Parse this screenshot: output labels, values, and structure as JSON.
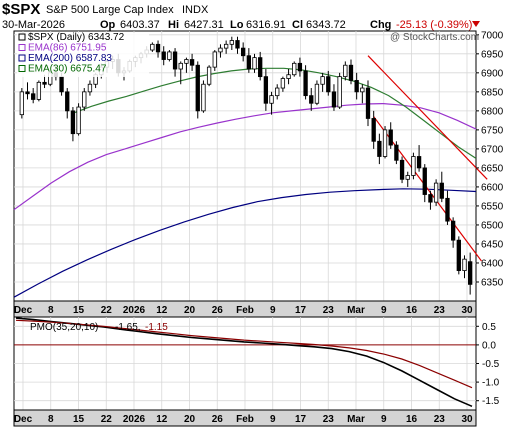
{
  "header": {
    "symbol": "$SPX",
    "name": "S&P 500 Large Cap Index",
    "exchange": "INDX",
    "date": "30-Mar-2026",
    "open_label": "Op",
    "open": "6403.37",
    "high_label": "Hi",
    "high": "6427.31",
    "low_label": "Lo",
    "low": "6316.91",
    "close_label": "Cl",
    "close": "6343.72",
    "chg_label": "Chg",
    "chg": "-25.13 (-0.39%)"
  },
  "watermark": "@ StockCharts.com",
  "legend": [
    {
      "label": "$SPX (Daily) 6343.72",
      "color": "#000000"
    },
    {
      "label": "EMA(86) 6751.95",
      "color": "#9933cc"
    },
    {
      "label": "EMA(200) 6587.83",
      "color": "#000080"
    },
    {
      "label": "EMA(30) 6675.47",
      "color": "#006600"
    }
  ],
  "pmo_legend": {
    "prefix": "PMO(35,20,10)",
    "pmo": "-1.65,",
    "signal": "-1.15"
  },
  "colors": {
    "up": "#ffffff",
    "down": "#000000",
    "ema86": "#9933cc",
    "ema200": "#000080",
    "ema30": "#2e7d32",
    "channel": "#dd0000",
    "pmo": "#000000",
    "pmo_signal": "#8b0000",
    "zero": "#8b0000"
  },
  "chart_data": [
    {
      "type": "candlestick",
      "title": "$SPX (Daily)",
      "x_ticks": [
        "Dec",
        "8",
        "15",
        "22",
        "2026",
        "12",
        "20",
        "26",
        "Feb",
        "9",
        "17",
        "23",
        "Mar",
        "9",
        "16",
        "23",
        "30"
      ],
      "ylim": [
        6300,
        7010
      ],
      "y_ticks": [
        6350,
        6400,
        6450,
        6500,
        6550,
        6600,
        6650,
        6700,
        6750,
        6800,
        6850,
        6900,
        6950,
        7000
      ],
      "ohlc": [
        [
          6790,
          6860,
          6780,
          6850
        ],
        [
          6850,
          6875,
          6830,
          6845
        ],
        [
          6845,
          6860,
          6820,
          6830
        ],
        [
          6830,
          6880,
          6825,
          6875
        ],
        [
          6875,
          6895,
          6860,
          6870
        ],
        [
          6870,
          6905,
          6865,
          6900
        ],
        [
          6900,
          6920,
          6880,
          6890
        ],
        [
          6890,
          6900,
          6840,
          6850
        ],
        [
          6850,
          6860,
          6780,
          6800
        ],
        [
          6800,
          6810,
          6720,
          6740
        ],
        [
          6740,
          6820,
          6735,
          6810
        ],
        [
          6810,
          6860,
          6800,
          6850
        ],
        [
          6850,
          6880,
          6840,
          6870
        ],
        [
          6870,
          6900,
          6860,
          6895
        ],
        [
          6895,
          6925,
          6885,
          6915
        ],
        [
          6915,
          6935,
          6900,
          6930
        ],
        [
          6930,
          6945,
          6910,
          6935
        ],
        [
          6935,
          6950,
          6890,
          6900
        ],
        [
          6900,
          6915,
          6880,
          6905
        ],
        [
          6905,
          6935,
          6900,
          6930
        ],
        [
          6930,
          6945,
          6915,
          6940
        ],
        [
          6940,
          6955,
          6925,
          6950
        ],
        [
          6950,
          6970,
          6940,
          6960
        ],
        [
          6960,
          6980,
          6955,
          6975
        ],
        [
          6975,
          6985,
          6940,
          6955
        ],
        [
          6955,
          6970,
          6920,
          6935
        ],
        [
          6935,
          6960,
          6930,
          6955
        ],
        [
          6955,
          6965,
          6890,
          6910
        ],
        [
          6910,
          6930,
          6870,
          6925
        ],
        [
          6925,
          6940,
          6900,
          6935
        ],
        [
          6935,
          6950,
          6905,
          6920
        ],
        [
          6920,
          6930,
          6780,
          6800
        ],
        [
          6800,
          6880,
          6795,
          6870
        ],
        [
          6870,
          6920,
          6865,
          6915
        ],
        [
          6915,
          6960,
          6905,
          6955
        ],
        [
          6955,
          6975,
          6940,
          6965
        ],
        [
          6965,
          6985,
          6950,
          6975
        ],
        [
          6975,
          6995,
          6960,
          6985
        ],
        [
          6985,
          6995,
          6950,
          6965
        ],
        [
          6965,
          6980,
          6930,
          6945
        ],
        [
          6945,
          6965,
          6900,
          6910
        ],
        [
          6910,
          6950,
          6900,
          6940
        ],
        [
          6940,
          6955,
          6880,
          6890
        ],
        [
          6890,
          6910,
          6800,
          6820
        ],
        [
          6820,
          6850,
          6790,
          6840
        ],
        [
          6840,
          6870,
          6830,
          6860
        ],
        [
          6860,
          6890,
          6850,
          6885
        ],
        [
          6885,
          6910,
          6870,
          6895
        ],
        [
          6895,
          6930,
          6890,
          6925
        ],
        [
          6925,
          6940,
          6890,
          6905
        ],
        [
          6905,
          6920,
          6830,
          6840
        ],
        [
          6840,
          6860,
          6800,
          6820
        ],
        [
          6820,
          6880,
          6815,
          6870
        ],
        [
          6870,
          6900,
          6850,
          6890
        ],
        [
          6890,
          6905,
          6840,
          6850
        ],
        [
          6850,
          6870,
          6800,
          6810
        ],
        [
          6810,
          6900,
          6805,
          6890
        ],
        [
          6890,
          6930,
          6880,
          6920
        ],
        [
          6920,
          6935,
          6870,
          6880
        ],
        [
          6880,
          6900,
          6830,
          6850
        ],
        [
          6850,
          6870,
          6820,
          6860
        ],
        [
          6860,
          6880,
          6760,
          6780
        ],
        [
          6780,
          6800,
          6700,
          6720
        ],
        [
          6720,
          6740,
          6660,
          6680
        ],
        [
          6680,
          6760,
          6675,
          6750
        ],
        [
          6750,
          6770,
          6700,
          6710
        ],
        [
          6710,
          6720,
          6660,
          6670
        ],
        [
          6670,
          6680,
          6610,
          6620
        ],
        [
          6620,
          6640,
          6600,
          6630
        ],
        [
          6630,
          6690,
          6620,
          6680
        ],
        [
          6680,
          6710,
          6640,
          6650
        ],
        [
          6650,
          6660,
          6560,
          6580
        ],
        [
          6580,
          6590,
          6540,
          6560
        ],
        [
          6560,
          6620,
          6550,
          6610
        ],
        [
          6610,
          6640,
          6560,
          6570
        ],
        [
          6570,
          6590,
          6500,
          6510
        ],
        [
          6510,
          6520,
          6440,
          6460
        ],
        [
          6460,
          6470,
          6370,
          6380
        ],
        [
          6380,
          6420,
          6360,
          6410
        ],
        [
          6403.37,
          6427.31,
          6316.91,
          6343.72
        ]
      ],
      "ema86": [
        6540,
        6575,
        6610,
        6640,
        6665,
        6685,
        6700,
        6715,
        6730,
        6745,
        6757,
        6768,
        6778,
        6787,
        6795,
        6800,
        6805,
        6810,
        6815,
        6818,
        6819,
        6815,
        6808,
        6795,
        6775,
        6752
      ],
      "ema200": [
        6310,
        6345,
        6378,
        6408,
        6436,
        6462,
        6486,
        6508,
        6528,
        6546,
        6561,
        6572,
        6580,
        6586,
        6590,
        6593,
        6595,
        6594,
        6591,
        6588
      ],
      "ema30": [
        6795,
        6812,
        6826,
        6838,
        6852,
        6866,
        6878,
        6889,
        6898,
        6905,
        6910,
        6912,
        6912,
        6908,
        6900,
        6890,
        6878,
        6862,
        6840,
        6810,
        6775,
        6740,
        6705,
        6675
      ],
      "channel_upper": [
        [
          61,
          6945
        ],
        [
          82,
          6620
        ]
      ],
      "channel_lower": [
        [
          62,
          6785
        ],
        [
          81,
          6405
        ]
      ]
    },
    {
      "type": "line",
      "title": "PMO(35,20,10)",
      "ylim": [
        -1.75,
        0.75
      ],
      "y_ticks": [
        0.5,
        0.0,
        -0.5,
        -1.0,
        -1.5
      ],
      "y_tick_labels": [
        "0.5",
        "0.0",
        "-0.5",
        "-1.0",
        "-1.5"
      ],
      "series": [
        {
          "name": "PMO",
          "values": [
            0.72,
            0.68,
            0.63,
            0.58,
            0.53,
            0.48,
            0.42,
            0.36,
            0.3,
            0.25,
            0.2,
            0.16,
            0.12,
            0.08,
            0.05,
            0.02,
            -0.02,
            -0.05,
            -0.1,
            -0.18,
            -0.3,
            -0.48,
            -0.7,
            -0.95,
            -1.2,
            -1.45,
            -1.65
          ]
        },
        {
          "name": "Signal",
          "values": [
            0.66,
            0.64,
            0.61,
            0.58,
            0.54,
            0.5,
            0.45,
            0.4,
            0.35,
            0.3,
            0.25,
            0.21,
            0.17,
            0.13,
            0.1,
            0.07,
            0.04,
            0.01,
            -0.03,
            -0.08,
            -0.15,
            -0.25,
            -0.38,
            -0.55,
            -0.75,
            -0.95,
            -1.15
          ]
        }
      ]
    }
  ]
}
